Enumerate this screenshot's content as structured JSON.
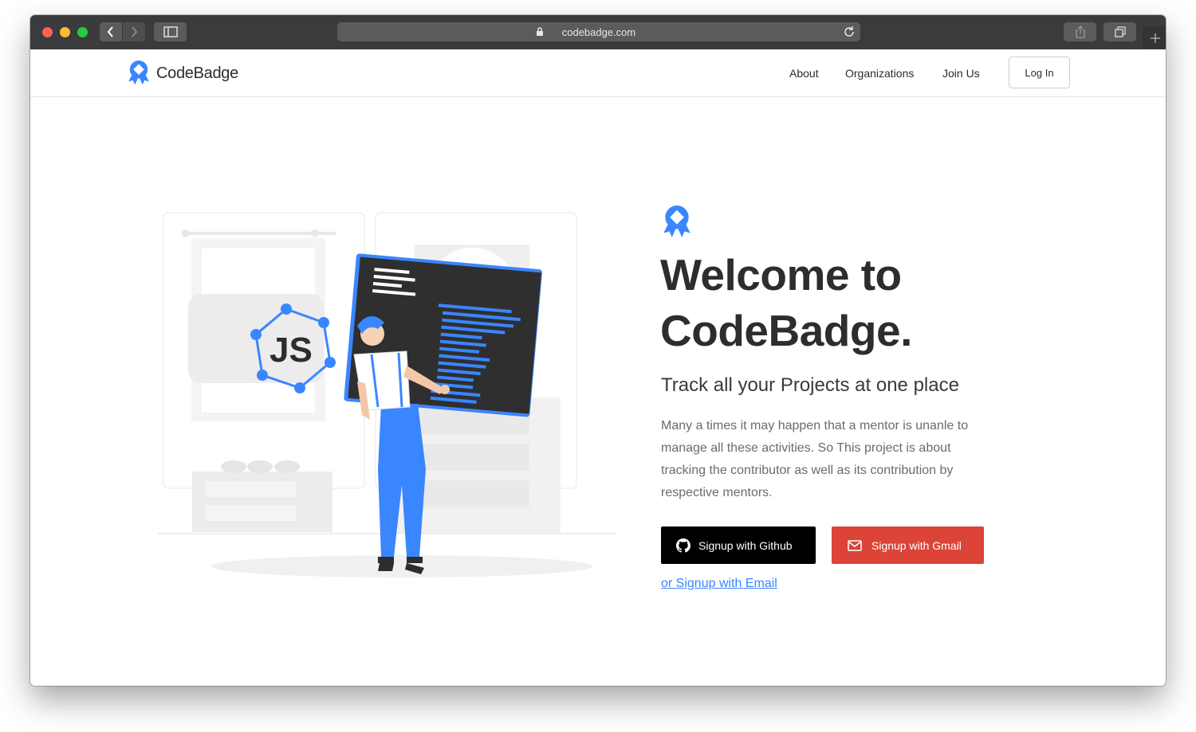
{
  "browser": {
    "url": "codebadge.com"
  },
  "header": {
    "brand": "CodeBadge",
    "nav": [
      "About",
      "Organizations",
      "Join Us"
    ],
    "login_label": "Log In"
  },
  "hero": {
    "title": "Welcome to CodeBadge.",
    "subtitle": "Track all your Projects at one place",
    "description": "Many a times it may happen that a mentor is unanle to manage all these activities. So This project is about tracking the contributor as well as its contribution by respective mentors.",
    "github_button": "Signup with Github",
    "gmail_button": "Signup with Gmail",
    "email_link": "or Signup with Email",
    "illustration_text": "JS"
  },
  "colors": {
    "accent": "#3a86ff",
    "gmail": "#db4437",
    "github": "#000000"
  }
}
